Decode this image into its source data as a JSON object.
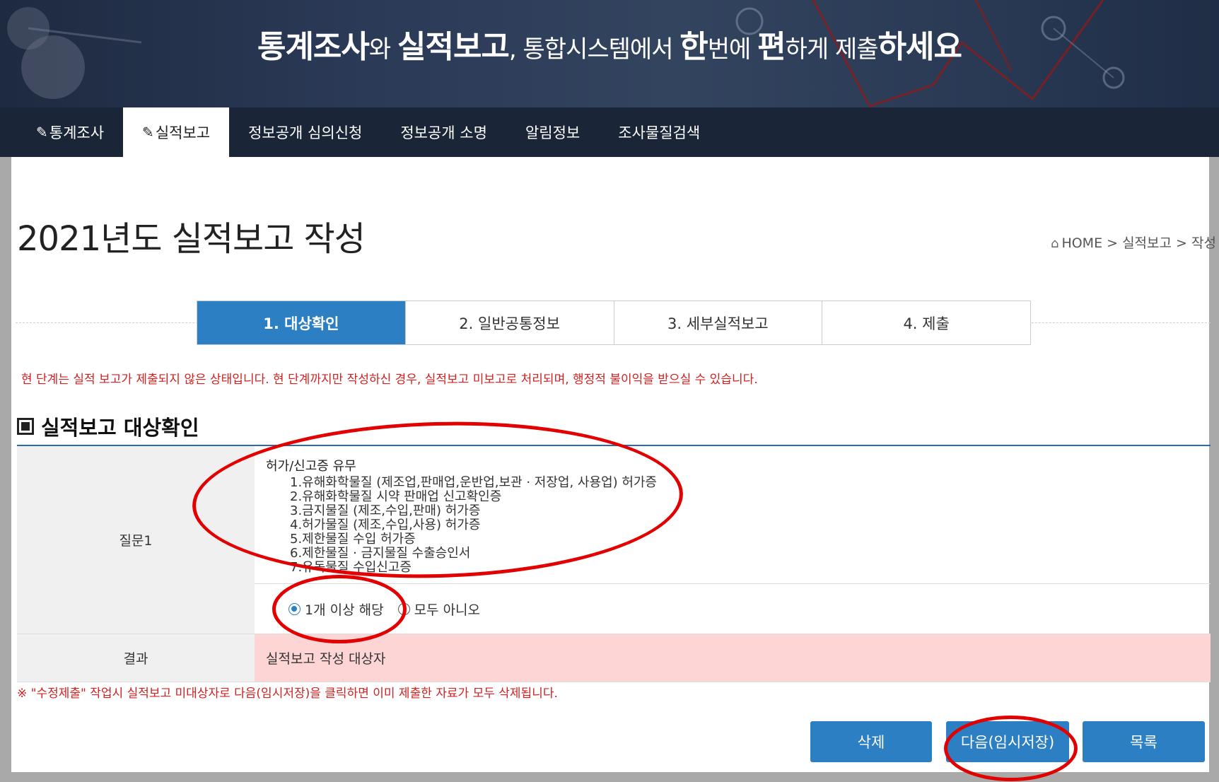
{
  "banner": {
    "parts": [
      {
        "text": "통계조사",
        "bold": true
      },
      {
        "text": "와 ",
        "bold": false
      },
      {
        "text": "실적보고",
        "bold": true
      },
      {
        "text": ", 통합시스템에서 ",
        "bold": false
      },
      {
        "text": "한",
        "bold": true
      },
      {
        "text": "번에 ",
        "bold": false
      },
      {
        "text": "편",
        "bold": true
      },
      {
        "text": "하게 제출",
        "bold": false
      },
      {
        "text": "하세요",
        "bold": true
      }
    ]
  },
  "nav": {
    "items": [
      {
        "label": "통계조사",
        "icon": "edit-icon"
      },
      {
        "label": "실적보고",
        "icon": "edit-icon"
      },
      {
        "label": "정보공개 심의신청"
      },
      {
        "label": "정보공개 소명"
      },
      {
        "label": "알림정보"
      },
      {
        "label": "조사물질검색"
      }
    ],
    "pen_glyph": "✎"
  },
  "page": {
    "title": "2021년도 실적보고 작성",
    "breadcrumb": "HOME > 실적보고 > 작성"
  },
  "steps": [
    {
      "label": "1. 대상확인",
      "active": true
    },
    {
      "label": "2. 일반공통정보",
      "active": false
    },
    {
      "label": "3. 세부실적보고",
      "active": false
    },
    {
      "label": "4. 제출",
      "active": false
    }
  ],
  "warning": "현 단계는 실적 보고가 제출되지 않은 상태입니다. 현 단계까지만 작성하신 경우, 실적보고 미보고로 처리되며, 행정적 불이익을 받으실 수 있습니다.",
  "section": {
    "title": "실적보고 대상확인"
  },
  "question": {
    "label": "질문1",
    "heading": "허가/신고증 유무",
    "items": [
      "1.유해화학물질 (제조업,판매업,운반업,보관 · 저장업, 사용업) 허가증",
      "2.유해화학물질 시약 판매업 신고확인증",
      "3.금지물질 (제조,수입,판매) 허가증",
      "4.허가물질 (제조,수입,사용) 허가증",
      "5.제한물질 수입 허가증",
      "6.제한물질 · 금지물질 수출승인서",
      "7.유독물질 수입신고증"
    ],
    "options": [
      {
        "label": "1개 이상 해당",
        "selected": true
      },
      {
        "label": "모두 아니오",
        "selected": false
      }
    ]
  },
  "result": {
    "label": "결과",
    "value": "실적보고 작성 대상자"
  },
  "note": "※ \"수정제출\" 작업시 실적보고 미대상자로 다음(임시저장)을 클릭하면 이미 제출한 자료가 모두 삭제됩니다.",
  "buttons": {
    "delete": "삭제",
    "next": "다음(임시저장)",
    "list": "목록"
  },
  "colors": {
    "accent": "#2d7fc4",
    "warning": "#d32020",
    "annotation": "#e20000",
    "result_bg": "#fdd5d5"
  }
}
